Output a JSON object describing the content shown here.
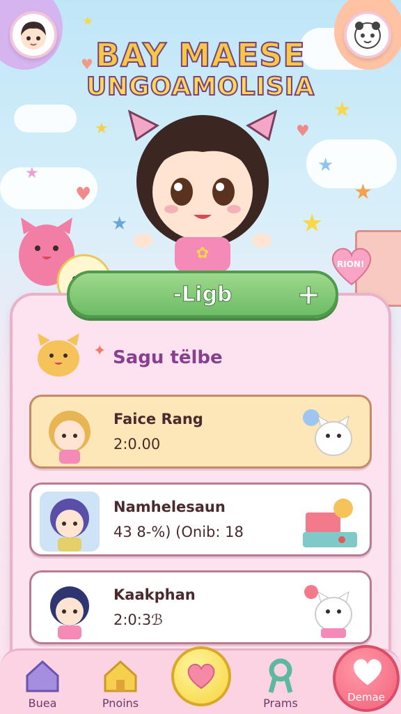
{
  "header": {
    "title_line1": "BAY MAESE",
    "title_line2": "UNGOAMOLISIA"
  },
  "play_button": {
    "label": "-Ligb",
    "plus": "+"
  },
  "section": {
    "title": "Sagu tëlbe"
  },
  "balloon_text": "RION!",
  "players": [
    {
      "name": "Faice Rang",
      "meta": "2:0.00",
      "active": true
    },
    {
      "name": "Namhelesaun",
      "meta": "43 8-%) (Onib: 18",
      "active": false
    },
    {
      "name": "Kaakphan",
      "meta": "2:0:3ℬ",
      "active": false
    }
  ],
  "nav": {
    "items": [
      {
        "label": "Buea",
        "icon": "house-purple-icon"
      },
      {
        "label": "Pnoins",
        "icon": "house-yellow-icon"
      },
      {
        "label": "",
        "icon": "heart-icon"
      },
      {
        "label": "Prams",
        "icon": "ribbon-icon"
      },
      {
        "label": "Demae",
        "icon": "heart-white-icon"
      }
    ]
  },
  "colors": {
    "accent_green": "#6dbd66",
    "panel_pink": "#fde3ef",
    "title_yellow": "#f7c845",
    "title_outline": "#7a3f7c",
    "card_active": "#fde7b8"
  }
}
